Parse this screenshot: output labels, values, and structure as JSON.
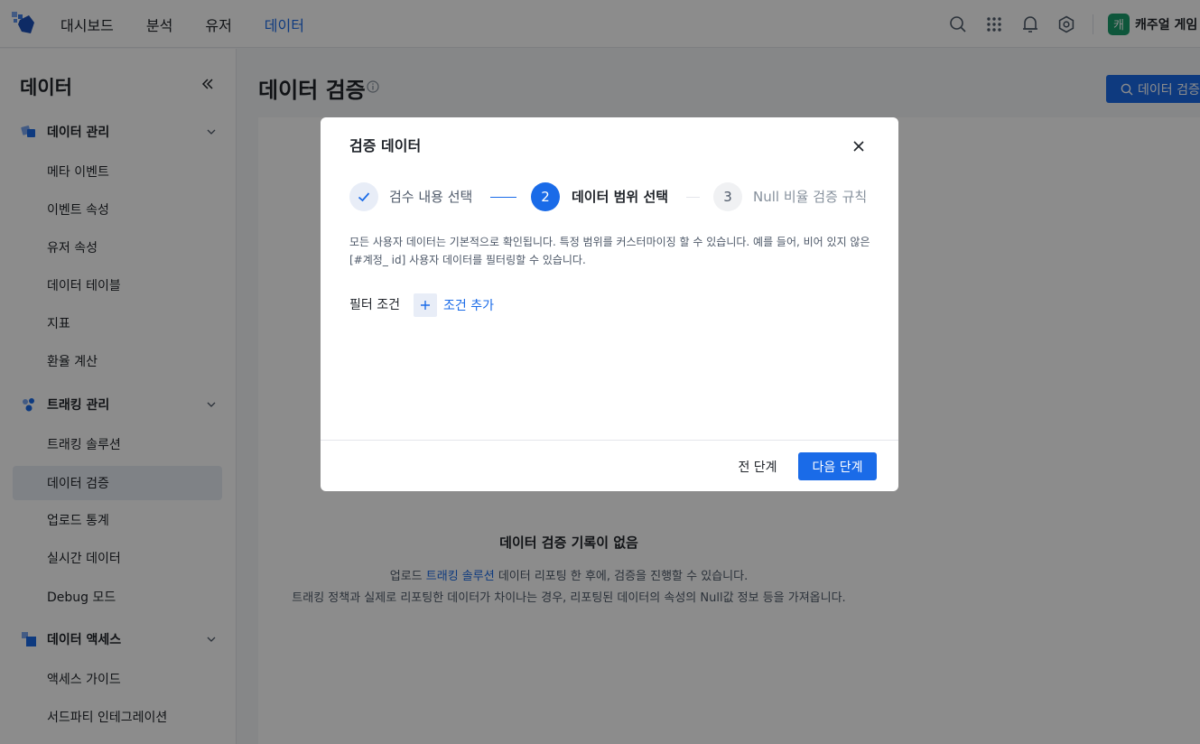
{
  "nav": {
    "items": [
      {
        "label": "대시보드"
      },
      {
        "label": "분석"
      },
      {
        "label": "유저"
      },
      {
        "label": "데이터"
      }
    ],
    "active_index": 3,
    "workspace": {
      "badge": "캐",
      "name": "캐주얼 게임"
    }
  },
  "sidebar": {
    "title": "데이터",
    "groups": [
      {
        "label": "데이터 관리",
        "icon": "cubes-icon",
        "items": [
          "메타 이벤트",
          "이벤트 속성",
          "유저 속성",
          "데이터 테이블",
          "지표",
          "환율 계산"
        ]
      },
      {
        "label": "트래킹 관리",
        "icon": "people-icon",
        "items": [
          "트래킹 솔루션",
          "데이터 검증",
          "업로드 통계",
          "실시간 데이터",
          "Debug 모드"
        ]
      },
      {
        "label": "데이터 액세스",
        "icon": "blocks-icon",
        "items": [
          "액세스 가이드",
          "서드파티 인테그레이션"
        ]
      }
    ],
    "active_item": "데이터 검증"
  },
  "main": {
    "title": "데이터 검증",
    "action_label": "데이터 검증",
    "empty": {
      "title": "데이터 검증 기록이 없음",
      "line1_pre": "업로드",
      "line1_link": "트래킹 솔루션",
      "line1_post": "데이터 리포팅 한 후에, 검증을 진행할 수 있습니다.",
      "line2": "트래킹 정책과 실제로 리포팅한 데이터가 차이나는 경우, 리포팅된 데이터의 속성의 Null값 정보 등을 가져옵니다."
    }
  },
  "modal": {
    "title": "검증 데이터",
    "steps": [
      {
        "label": "검수 내용 선택",
        "status": "done"
      },
      {
        "number": "2",
        "label": "데이터 범위 선택",
        "status": "active"
      },
      {
        "number": "3",
        "label": "Null 비율 검증 규칙",
        "status": "todo"
      }
    ],
    "description": "모든 사용자 데이터는 기본적으로 확인됩니다. 특정 범위를 커스터마이징 할 수 있습니다. 예를 들어, 비어 있지 않은 [#계정_ id] 사용자 데이터를 필터링할 수 있습니다.",
    "filter_label": "필터 조건",
    "add_condition": "조건 추가",
    "prev_label": "전 단계",
    "next_label": "다음 단계"
  },
  "colors": {
    "accent": "#1a6be8",
    "workspace_badge": "#1a9d6c"
  }
}
